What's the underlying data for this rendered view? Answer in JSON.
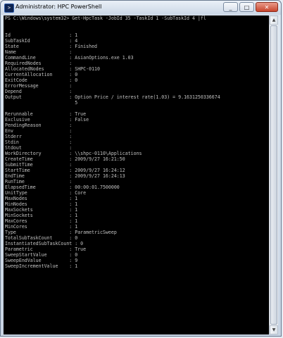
{
  "window": {
    "title": "Administrator: HPC PowerShell",
    "minimize_glyph": "_",
    "maximize_glyph": "□",
    "close_glyph": "✕",
    "app_icon": "powershell-icon"
  },
  "console": {
    "lines": [
      "PS C:\\Windows\\system32> Get-HpcTask -JobId 35 -TaskId 1 -SubTaskId 4 |fl",
      "",
      "",
      "Id                     : 1",
      "SubTaskId              : 4",
      "State                  : Finished",
      "Name                   :",
      "CommandLine            : AsianOptions.exe 1.03",
      "RequiredNodes          :",
      "AllocatedNodes         : SHPC-0110",
      "CurrentAllocation      : 0",
      "ExitCode               : 0",
      "ErrorMessage           :",
      "Depend                 :",
      "Output                 : Option Price / interest rate(1.03) = 9.1631250336674",
      "                         5",
      "",
      "Rerunnable             : True",
      "Exclusive              : False",
      "PendingReason          :",
      "Env                    :",
      "Stderr                 :",
      "Stdin                  :",
      "Stdout                 :",
      "WorkDirectory          : \\\\shpc-0110\\Applications",
      "CreateTime             : 2009/9/27 16:21:50",
      "SubmitTime             :",
      "StartTime              : 2009/9/27 16:24:12",
      "EndTime                : 2009/9/27 16:24:13",
      "RunTime                :",
      "ElapsedTime            : 00:00:01.7500000",
      "UnitType               : Core",
      "MaxNodes               : 1",
      "MinNodes               : 1",
      "MaxSockets             : 1",
      "MinSockets             : 1",
      "MaxCores               : 1",
      "MinCores               : 1",
      "Type                   : ParametricSweep",
      "TotalSubTaskCount      : 0",
      "InstantiatedSubTaskCount : 0",
      "Parametric             : True",
      "SweepStartValue        : 0",
      "SweepEndValue          : 9",
      "SweepIncrementValue    : 1"
    ]
  },
  "scrollbar": {
    "up_glyph": "▲",
    "down_glyph": "▼"
  },
  "colors": {
    "console_bg": "#000000",
    "console_text": "#c0c0c0",
    "close_button": "#c8452c"
  }
}
